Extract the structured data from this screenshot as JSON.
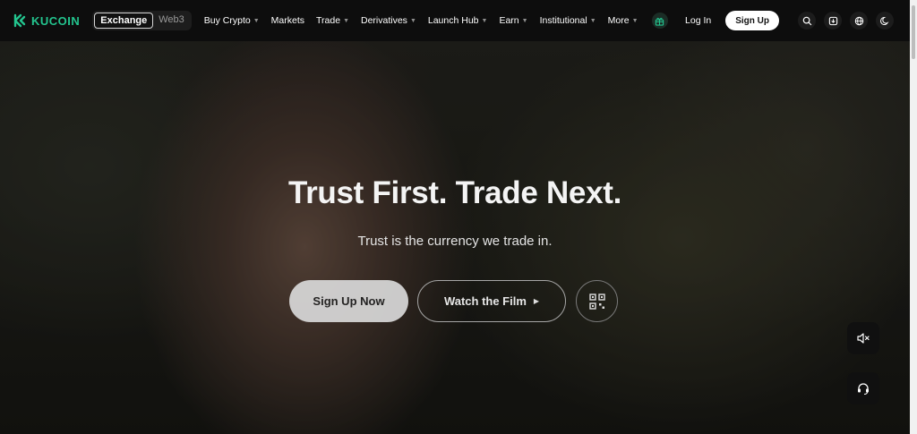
{
  "brand": {
    "name": "KUCOIN",
    "color": "#23c48e"
  },
  "nav": {
    "segments": [
      {
        "label": "Exchange",
        "active": true
      },
      {
        "label": "Web3",
        "active": false
      }
    ],
    "menu": [
      {
        "label": "Buy Crypto",
        "dropdown": true
      },
      {
        "label": "Markets",
        "dropdown": false
      },
      {
        "label": "Trade",
        "dropdown": true
      },
      {
        "label": "Derivatives",
        "dropdown": true
      },
      {
        "label": "Launch Hub",
        "dropdown": true
      },
      {
        "label": "Earn",
        "dropdown": true
      },
      {
        "label": "Institutional",
        "dropdown": true
      },
      {
        "label": "More",
        "dropdown": true
      }
    ],
    "gift_icon": "gift-icon",
    "login_label": "Log In",
    "signup_label": "Sign Up",
    "right_icons": [
      "search-icon",
      "download-icon",
      "globe-icon",
      "moon-icon"
    ]
  },
  "hero": {
    "title": "Trust First. Trade Next.",
    "subtitle": "Trust is the currency we trade in.",
    "primary_cta": "Sign Up Now",
    "secondary_cta": "Watch the Film",
    "qr_icon": "qr-code-icon"
  },
  "floating": {
    "mute_icon": "speaker-muted-icon",
    "support_icon": "headset-icon"
  }
}
